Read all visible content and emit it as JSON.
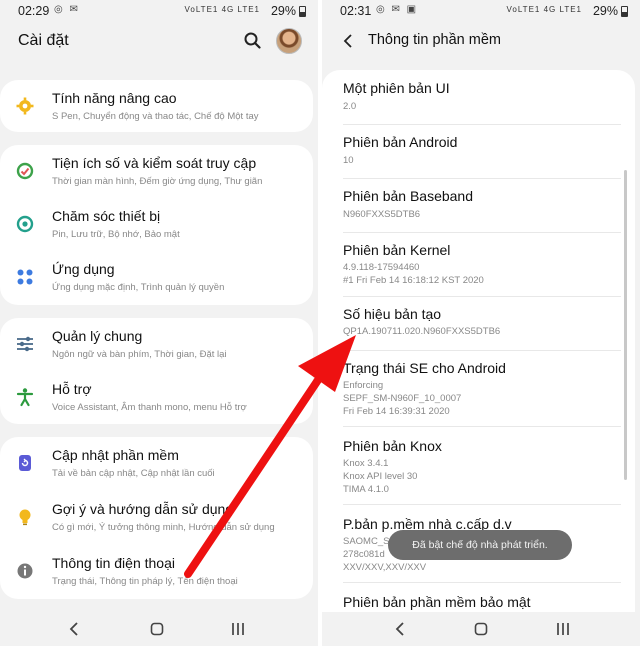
{
  "left_screen": {
    "status": {
      "time": "02:29",
      "icons": "◎ ✉",
      "network": "VoLTE1 4G LTE1",
      "battery": "29%"
    },
    "title": "Cài đặt",
    "search_icon": "search-icon",
    "cards": [
      {
        "items": [
          {
            "title": "Tính năng nâng cao",
            "subtitle": "S Pen, Chuyển động và thao tác, Chế độ Một tay",
            "icon": "star-gear-icon",
            "color": "#f2b81d"
          }
        ]
      },
      {
        "items": [
          {
            "title": "Tiện ích số và kiểm soát truy cập",
            "subtitle": "Thời gian màn hình, Đếm giờ ứng dụng, Thư giãn",
            "icon": "digital-wellbeing-icon",
            "color": "#3da24a"
          },
          {
            "title": "Chăm sóc thiết bị",
            "subtitle": "Pin, Lưu trữ, Bộ nhớ, Bảo mật",
            "icon": "device-care-icon",
            "color": "#23a08c"
          },
          {
            "title": "Ứng dụng",
            "subtitle": "Ứng dụng mặc định, Trình quản lý quyền",
            "icon": "apps-icon",
            "color": "#3d7be0"
          }
        ]
      },
      {
        "items": [
          {
            "title": "Quản lý chung",
            "subtitle": "Ngôn ngữ và bàn phím, Thời gian, Đặt lại",
            "icon": "sliders-icon",
            "color": "#4a6b8a"
          },
          {
            "title": "Hỗ trợ",
            "subtitle": "Voice Assistant, Âm thanh mono, menu Hỗ trợ",
            "icon": "accessibility-icon",
            "color": "#2c9a3e"
          }
        ]
      },
      {
        "items": [
          {
            "title": "Cập nhật phần mềm",
            "subtitle": "Tải về bản cập nhật, Cập nhật lần cuối",
            "icon": "software-update-icon",
            "color": "#5b5bd6"
          },
          {
            "title": "Gợi ý và hướng dẫn sử dụng",
            "subtitle": "Có gì mới, Ý tưởng thông minh, Hướng dẫn sử dụng",
            "icon": "lightbulb-icon",
            "color": "#f2b81d"
          },
          {
            "title": "Thông tin điện thoại",
            "subtitle": "Trạng thái, Thông tin pháp lý, Tên điện thoại",
            "icon": "info-icon",
            "color": "#666666"
          }
        ]
      }
    ]
  },
  "right_screen": {
    "status": {
      "time": "02:31",
      "icons": "◎ ✉ ▣",
      "network": "VoLTE1 4G LTE1",
      "battery": "29%"
    },
    "title": "Thông tin phần mềm",
    "items": [
      {
        "title": "Một phiên bản UI",
        "lines": [
          "2.0"
        ]
      },
      {
        "title": "Phiên bản Android",
        "lines": [
          "10"
        ]
      },
      {
        "title": "Phiên bản Baseband",
        "lines": [
          "N960FXXS5DTB6"
        ]
      },
      {
        "title": "Phiên bản Kernel",
        "lines": [
          "4.9.118-17594460",
          "#1 Fri Feb 14 16:18:12 KST 2020"
        ]
      },
      {
        "title": "Số hiệu bản tạo",
        "lines": [
          "QP1A.190711.020.N960FXXS5DTB6"
        ]
      },
      {
        "title": "Trạng thái SE cho Android",
        "lines": [
          "Enforcing",
          "SEPF_SM-N960F_10_0007",
          "Fri Feb 14 16:39:31 2020"
        ]
      },
      {
        "title": "Phiên bản Knox",
        "lines": [
          "Knox 3.4.1",
          "Knox API level 30",
          "TIMA 4.1.0"
        ]
      },
      {
        "title": "P.bản p.mềm nhà c.cấp d.v",
        "lines": [
          "SAOMC_SM",
          "278c081d",
          "XXV/XXV,XXV/XXV"
        ]
      },
      {
        "title": "Phiên bản phần mềm bảo mật",
        "lines": []
      }
    ],
    "toast": "Đã bật chế độ nhà phát triển."
  },
  "colors": {
    "background": "#f2f2f2",
    "card": "#ffffff",
    "arrow": "#ee1111"
  }
}
